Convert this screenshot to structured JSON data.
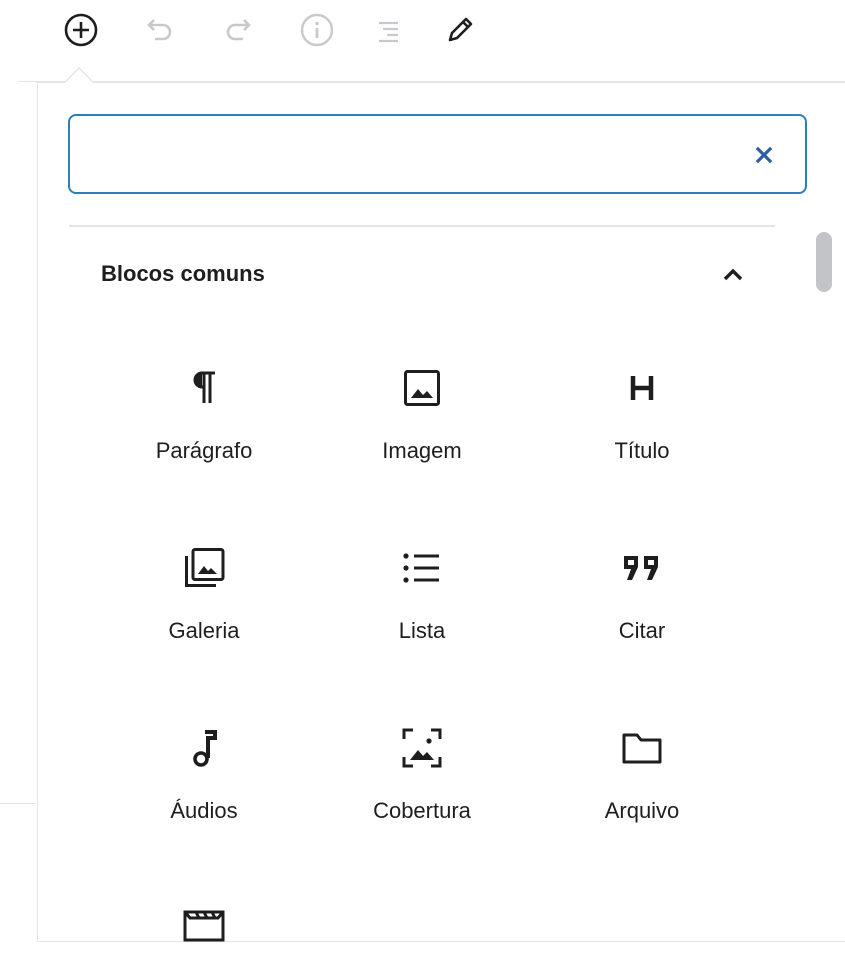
{
  "toolbar": {
    "buttons": [
      {
        "name": "add-block",
        "icon": "plus-circle-icon"
      },
      {
        "name": "undo",
        "icon": "undo-icon"
      },
      {
        "name": "redo",
        "icon": "redo-icon"
      },
      {
        "name": "info",
        "icon": "info-icon"
      },
      {
        "name": "outline",
        "icon": "list-view-icon"
      },
      {
        "name": "tools",
        "icon": "pencil-icon"
      }
    ]
  },
  "inserter": {
    "search": {
      "value": "",
      "placeholder": ""
    },
    "clear_icon": "close-icon",
    "panel": {
      "title": "Blocos comuns",
      "toggle_icon": "chevron-up-icon",
      "blocks": [
        {
          "label": "Parágrafo",
          "icon": "paragraph-icon"
        },
        {
          "label": "Imagem",
          "icon": "image-icon"
        },
        {
          "label": "Título",
          "icon": "heading-icon"
        },
        {
          "label": "Galeria",
          "icon": "gallery-icon"
        },
        {
          "label": "Lista",
          "icon": "list-icon"
        },
        {
          "label": "Citar",
          "icon": "quote-icon"
        },
        {
          "label": "Áudios",
          "icon": "audio-icon"
        },
        {
          "label": "Cobertura",
          "icon": "cover-icon"
        },
        {
          "label": "Arquivo",
          "icon": "file-icon"
        },
        {
          "label": "",
          "icon": "video-icon"
        }
      ]
    }
  },
  "colors": {
    "focus_border": "#2e7fb8",
    "text": "#1e1e1e",
    "disabled": "#c7c9cc",
    "divider": "#e2e4e7"
  }
}
